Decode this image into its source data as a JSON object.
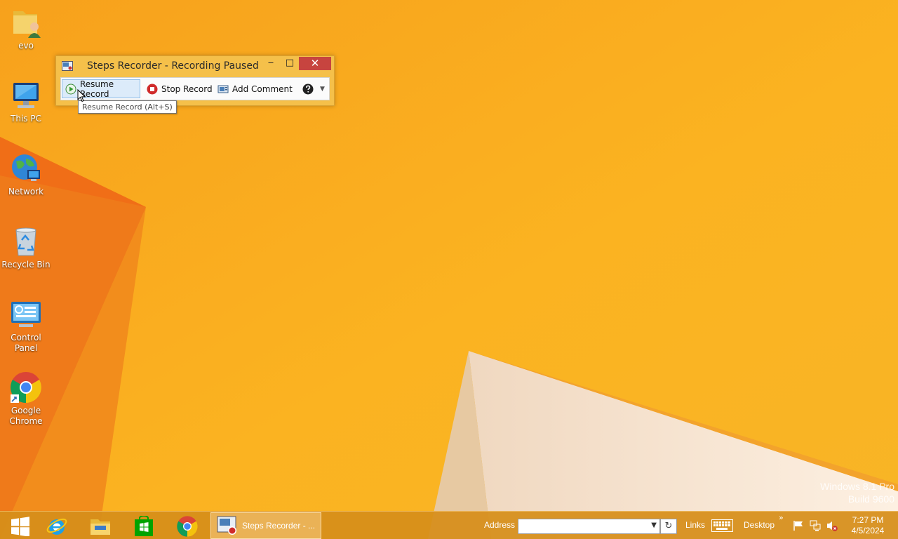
{
  "desktop": {
    "icons": [
      {
        "label": "evo",
        "icon": "user-folder-icon"
      },
      {
        "label": "This PC",
        "icon": "computer-icon"
      },
      {
        "label": "Network",
        "icon": "network-globe-icon"
      },
      {
        "label": "Recycle Bin",
        "icon": "recycle-bin-icon"
      },
      {
        "label": "Control Panel",
        "icon": "control-panel-icon"
      },
      {
        "label": "Google Chrome",
        "icon": "chrome-icon"
      }
    ]
  },
  "steps_recorder": {
    "title": "Steps Recorder - Recording Paused",
    "minimize_glyph": "‒",
    "maximize_glyph": "□",
    "close_glyph": "✕",
    "toolbar": {
      "resume_label": "Resume Record",
      "stop_label": "Stop Record",
      "comment_label": "Add Comment",
      "dropdown_glyph": "▼"
    },
    "tooltip": "Resume Record (Alt+S)"
  },
  "watermark": {
    "line1": "Windows 8.1 Pro",
    "line2": "Build 9600"
  },
  "taskbar": {
    "pinned": [
      "start-icon",
      "internet-explorer-icon",
      "file-explorer-icon",
      "store-icon",
      "chrome-icon"
    ],
    "active_task_label": "Steps Recorder - ...",
    "address_label": "Address",
    "address_value": "",
    "links_label": "Links",
    "desktop_label": "Desktop",
    "chevron": "»",
    "time": "7:27 PM",
    "date": "4/5/2024"
  },
  "colors": {
    "accent": "#f6a21a",
    "window_frame": "#f5c04a",
    "close_button": "#c7443f",
    "taskbar": "#d68e1a"
  }
}
